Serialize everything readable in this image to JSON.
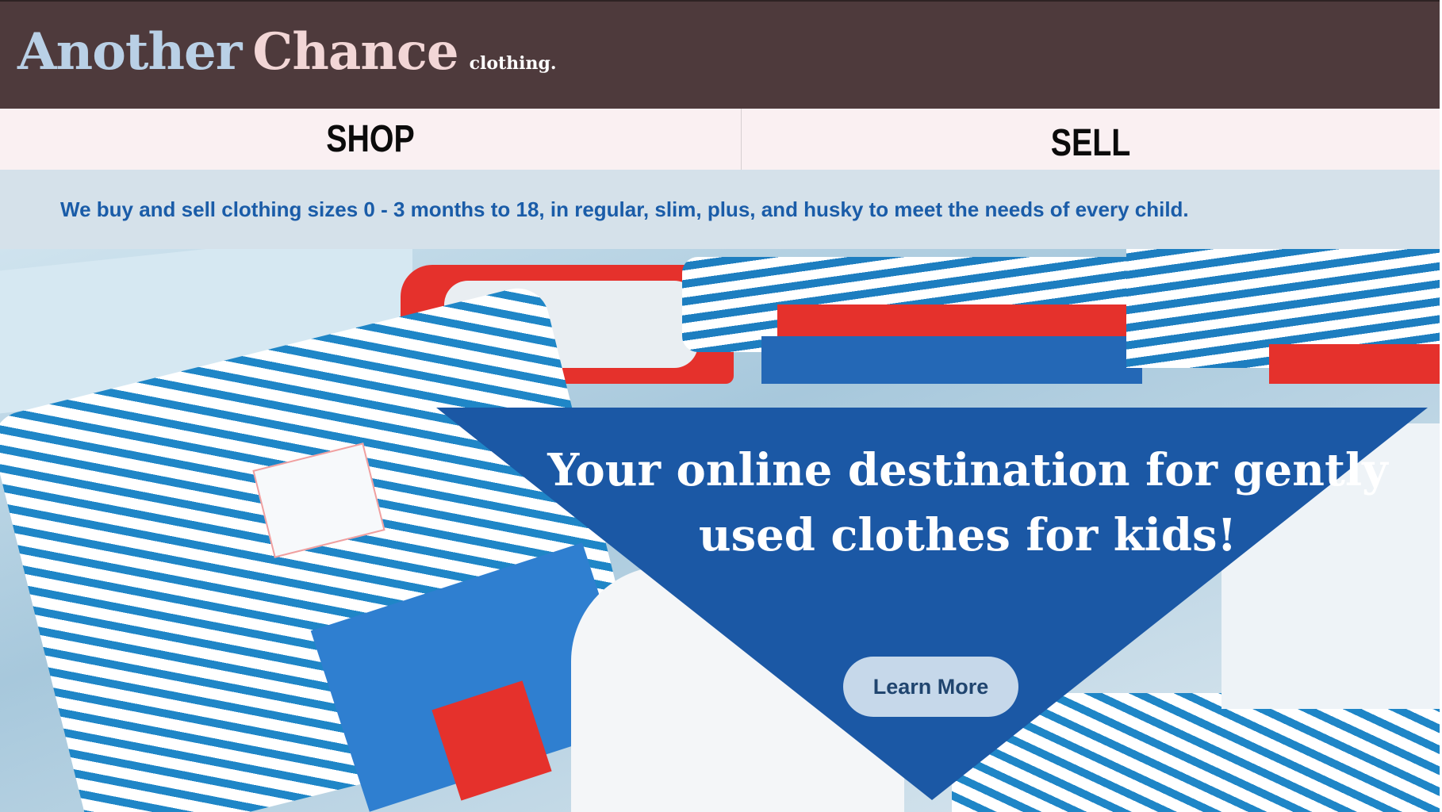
{
  "brand": {
    "word1": "Another",
    "word2": "Chance",
    "tagline": "clothing.",
    "header_color": "#4e3a3c",
    "word1_color": "#b9d0e6",
    "word2_color": "#f2d6d6"
  },
  "nav": {
    "items": [
      {
        "label": "SHOP"
      },
      {
        "label": "SELL"
      }
    ],
    "background": "#faf0f2"
  },
  "info_strip": {
    "text": "We buy and sell clothing sizes 0 - 3 months to 18, in regular, slim, plus, and husky to meet the needs of every child.",
    "text_color": "#1a5ca8",
    "background": "#d5e1ea"
  },
  "hero": {
    "image": "photo of folded striped children's clothes (blue/white stripes, red trim)",
    "headline": "Your online destination for gently used clothes for kids!",
    "banner_color": "#1b58a5",
    "cta_label": "Learn More",
    "cta_color": "#c6d8ea"
  }
}
